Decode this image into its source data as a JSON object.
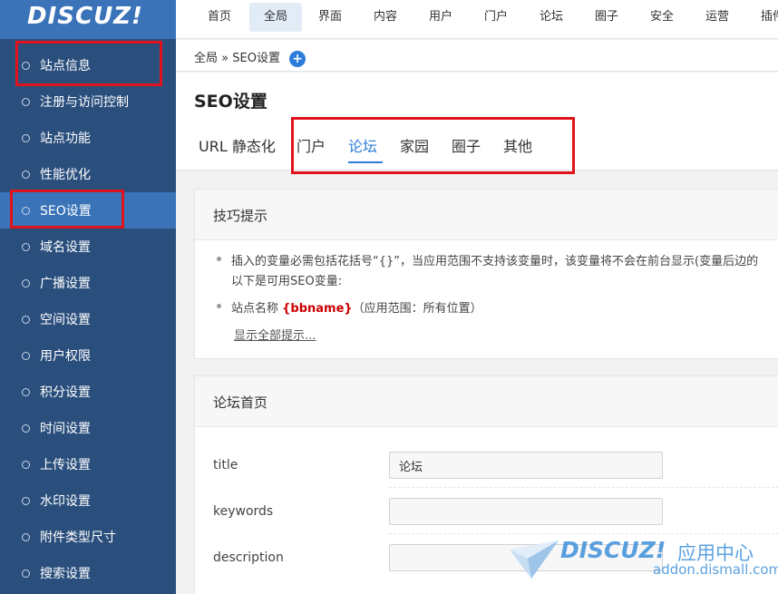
{
  "app": {
    "logo": "DISCUZ!"
  },
  "top_nav": [
    "首页",
    "全局",
    "界面",
    "内容",
    "用户",
    "门户",
    "论坛",
    "圈子",
    "安全",
    "运营",
    "插件"
  ],
  "active_top_nav": "全局",
  "sidebar": {
    "items": [
      "站点信息",
      "注册与访问控制",
      "站点功能",
      "性能优化",
      "SEO设置",
      "域名设置",
      "广播设置",
      "空间设置",
      "用户权限",
      "积分设置",
      "时间设置",
      "上传设置",
      "水印设置",
      "附件类型尺寸",
      "搜索设置"
    ],
    "active": "SEO设置"
  },
  "breadcrumb": {
    "root": "全局",
    "separator": "»",
    "current": "SEO设置",
    "add_icon": "plus-circle-icon"
  },
  "page": {
    "title": "SEO设置",
    "tabs": [
      "URL 静态化",
      "门户",
      "论坛",
      "家园",
      "圈子",
      "其他"
    ],
    "active_tab": "论坛"
  },
  "tips": {
    "title": "技巧提示",
    "line1": "插入的变量必需包括花括号“{}”，当应用范围不支持该变量时，该变量将不会在前台显示(变量后边的",
    "line2": "以下是可用SEO变量:",
    "var_prefix": "站点名称",
    "var_name": "{bbname}",
    "var_scope": "（应用范围：所有位置）",
    "show_all": "显示全部提示..."
  },
  "forum_home": {
    "title": "论坛首页",
    "fields": [
      {
        "label": "title",
        "value": ""
      },
      {
        "label": "keywords",
        "value": ""
      },
      {
        "label": "description",
        "value": ""
      }
    ],
    "title_value": "论坛"
  },
  "watermark": {
    "brand": "DISCUZ!",
    "suffix": "应用中心",
    "url": "addon.dismall.com"
  },
  "colors": {
    "sidebar_bg": "#2b4f7d",
    "sidebar_active": "#3b73b9",
    "accent": "#2e7cd9",
    "highlight_box": "#e0121b",
    "variable": "#cc0000"
  }
}
